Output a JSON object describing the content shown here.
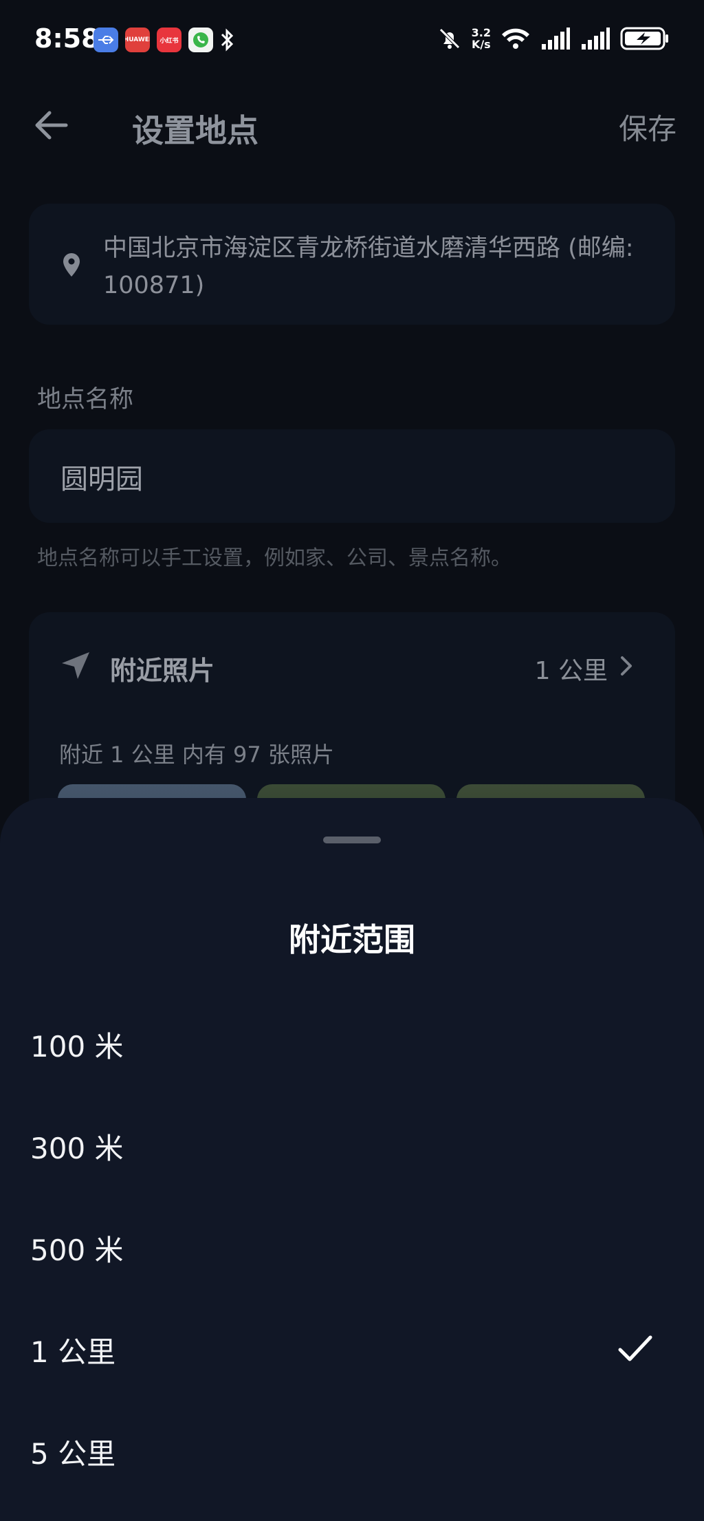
{
  "status_bar": {
    "time": "8:58",
    "app_icons": [
      {
        "name": "usb-icon",
        "label": "⇆"
      },
      {
        "name": "huawei-app-icon",
        "label": "HUAWEI"
      },
      {
        "name": "xiaohongshu-icon",
        "label": "小红书"
      },
      {
        "name": "phone-call-icon",
        "label": "📞"
      }
    ],
    "net_speed_value": "3.2",
    "net_speed_unit": "K/s"
  },
  "header": {
    "title": "设置地点",
    "save_label": "保存"
  },
  "address": {
    "text": "中国北京市海淀区青龙桥街道水磨清华西路 (邮编: 100871)"
  },
  "place_name": {
    "label": "地点名称",
    "value": "圆明园",
    "hint": "地点名称可以手工设置，例如家、公司、景点名称。"
  },
  "nearby": {
    "title": "附近照片",
    "range": "1 公里",
    "count_text": "附近 1 公里 内有 97 张照片"
  },
  "sheet": {
    "title": "附近范围",
    "options": [
      {
        "label": "100 米",
        "selected": false
      },
      {
        "label": "300 米",
        "selected": false
      },
      {
        "label": "500 米",
        "selected": false
      },
      {
        "label": "1 公里",
        "selected": true
      },
      {
        "label": "5 公里",
        "selected": false
      }
    ]
  },
  "colors": {
    "background": "#0b0e15",
    "card": "#0e141f",
    "sheet": "#111726",
    "text_primary": "#ffffff"
  }
}
